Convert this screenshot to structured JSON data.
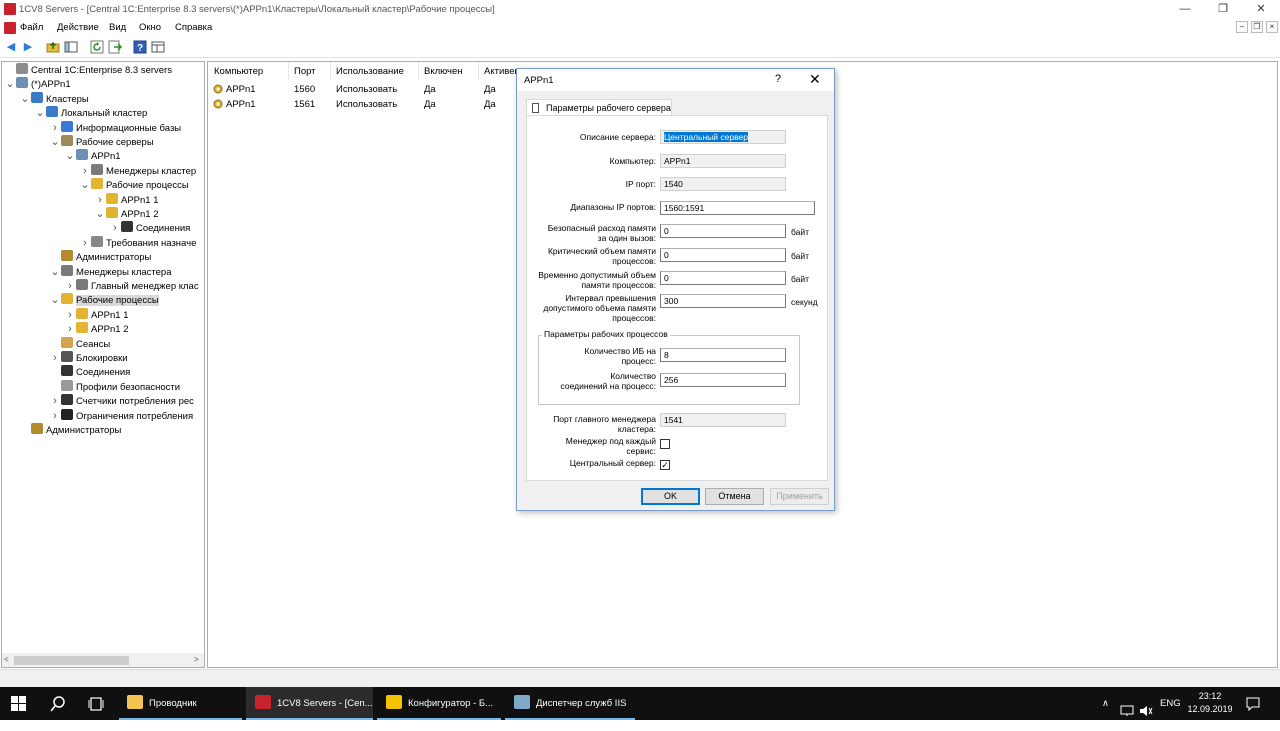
{
  "window": {
    "title": "1CV8 Servers - [Central 1C:Enterprise 8.3 servers\\(*)APPn1\\Кластеры\\Локальный кластер\\Рабочие процессы]",
    "minimize": "—",
    "maximize": "❐",
    "close": "✕"
  },
  "menu": {
    "items": [
      "Файл",
      "Действие",
      "Вид",
      "Окно",
      "Справка"
    ],
    "mdi": [
      "–",
      "❐",
      "×"
    ]
  },
  "tree": [
    {
      "label": "Central 1C:Enterprise 8.3 servers",
      "level": 0,
      "chev": "",
      "icon": "server-group-icon"
    },
    {
      "label": "(*)APPn1",
      "level": 0,
      "chev": "v",
      "icon": "server-icon"
    },
    {
      "label": "Кластеры",
      "level": 1,
      "chev": "v",
      "icon": "clusters-icon"
    },
    {
      "label": "Локальный кластер",
      "level": 2,
      "chev": "v",
      "icon": "cluster-icon"
    },
    {
      "label": "Информационные базы",
      "level": 3,
      "chev": ">",
      "icon": "database-icon"
    },
    {
      "label": "Рабочие серверы",
      "level": 3,
      "chev": "v",
      "icon": "servers-icon"
    },
    {
      "label": "APPn1",
      "level": 4,
      "chev": "v",
      "icon": "server-icon"
    },
    {
      "label": "Менеджеры кластер",
      "level": 5,
      "chev": ">",
      "icon": "list-icon"
    },
    {
      "label": "Рабочие процессы",
      "level": 5,
      "chev": "v",
      "icon": "processes-icon"
    },
    {
      "label": "APPn1 1",
      "level": 6,
      "chev": ">",
      "icon": "process-icon"
    },
    {
      "label": "APPn1 2",
      "level": 6,
      "chev": "v",
      "icon": "process-icon"
    },
    {
      "label": "Соединения",
      "level": 7,
      "chev": ">",
      "icon": "connections-icon"
    },
    {
      "label": "Требования назначе",
      "level": 5,
      "chev": ">",
      "icon": "requirements-icon"
    },
    {
      "label": "Администраторы",
      "level": 3,
      "chev": "",
      "icon": "admins-icon"
    },
    {
      "label": "Менеджеры кластера",
      "level": 3,
      "chev": "v",
      "icon": "list-icon"
    },
    {
      "label": "Главный менеджер клас",
      "level": 4,
      "chev": ">",
      "icon": "list-icon"
    },
    {
      "label": "Рабочие процессы",
      "level": 3,
      "chev": "v",
      "icon": "processes-icon",
      "selected": true
    },
    {
      "label": "APPn1 1",
      "level": 4,
      "chev": ">",
      "icon": "process-icon"
    },
    {
      "label": "APPn1 2",
      "level": 4,
      "chev": ">",
      "icon": "process-icon"
    },
    {
      "label": "Сеансы",
      "level": 3,
      "chev": "",
      "icon": "sessions-icon"
    },
    {
      "label": "Блокировки",
      "level": 3,
      "chev": ">",
      "icon": "locks-icon"
    },
    {
      "label": "Соединения",
      "level": 3,
      "chev": "",
      "icon": "connections-icon"
    },
    {
      "label": "Профили безопасности",
      "level": 3,
      "chev": "",
      "icon": "security-profile-icon"
    },
    {
      "label": "Счетчики потребления рес",
      "level": 3,
      "chev": ">",
      "icon": "counters-icon"
    },
    {
      "label": "Ограничения потребления",
      "level": 3,
      "chev": ">",
      "icon": "limits-icon"
    },
    {
      "label": "Администраторы",
      "level": 1,
      "chev": "",
      "icon": "admins-icon"
    }
  ],
  "list": {
    "columns": [
      "Компьютер",
      "Порт",
      "Использование",
      "Включен",
      "Активен"
    ],
    "rows": [
      [
        "APPn1",
        "1560",
        "Использовать",
        "Да",
        "Да"
      ],
      [
        "APPn1",
        "1561",
        "Использовать",
        "Да",
        "Да"
      ]
    ]
  },
  "dialog": {
    "title": "APPn1",
    "help": "?",
    "close": "✕",
    "tab": "Параметры рабочего сервера",
    "fields": {
      "description_label": "Описание сервера:",
      "description_value": "Центральный сервер",
      "computer_label": "Компьютер:",
      "computer_value": "APPn1",
      "ip_port_label": "IP порт:",
      "ip_port_value": "1540",
      "ip_range_label": "Диапазоны IP портов:",
      "ip_range_value": "1560:1591",
      "safe_mem_label_1": "Безопасный расход памяти",
      "safe_mem_label_2": "за один вызов:",
      "safe_mem_value": "0",
      "crit_mem_label_1": "Критический объем памяти",
      "crit_mem_label_2": "процессов:",
      "crit_mem_value": "0",
      "temp_mem_label_1": "Временно допустимый объем",
      "temp_mem_label_2": "памяти процессов:",
      "temp_mem_value": "0",
      "interval_label_1": "Интервал превышения",
      "interval_label_2": "допустимого объема памяти",
      "interval_label_3": "процессов:",
      "interval_value": "300",
      "unit_bytes": "байт",
      "unit_seconds": "секунд"
    },
    "group": {
      "title": "Параметры рабочих процессов",
      "ib_label_1": "Количество ИБ на",
      "ib_label_2": "процесс:",
      "ib_value": "8",
      "conn_label_1": "Количество",
      "conn_label_2": "соединений на процесс:",
      "conn_value": "256"
    },
    "main_manager_port_label_1": "Порт главного менеджера",
    "main_manager_port_label_2": "кластера:",
    "main_manager_port_value": "1541",
    "manager_per_service_label_1": "Менеджер под каждый",
    "manager_per_service_label_2": "сервис:",
    "manager_per_service_checked": false,
    "central_server_label": "Центральный сервер:",
    "central_server_checked": true,
    "check_mark": "✓",
    "buttons": {
      "ok": "OK",
      "cancel": "Отмена",
      "apply": "Применить"
    }
  },
  "taskbar": {
    "items": [
      {
        "label": "Проводник",
        "icon": "folder-icon",
        "color": "#f3c44f"
      },
      {
        "label": "1CV8 Servers - [Cen...",
        "icon": "1cv8-servers-icon",
        "color": "#c8232c",
        "active": true
      },
      {
        "label": "Конфигуратор - Б...",
        "icon": "configurator-icon",
        "color": "#f5c400"
      },
      {
        "label": "Диспетчер служб IIS",
        "icon": "iis-icon",
        "color": "#7fa9c9"
      }
    ],
    "lang": "ENG",
    "time": "23:12",
    "date": "12.09.2019"
  },
  "colors": {
    "accent": "#0078d7",
    "taskbar": "#101010",
    "selection": "#d9d9d9"
  }
}
